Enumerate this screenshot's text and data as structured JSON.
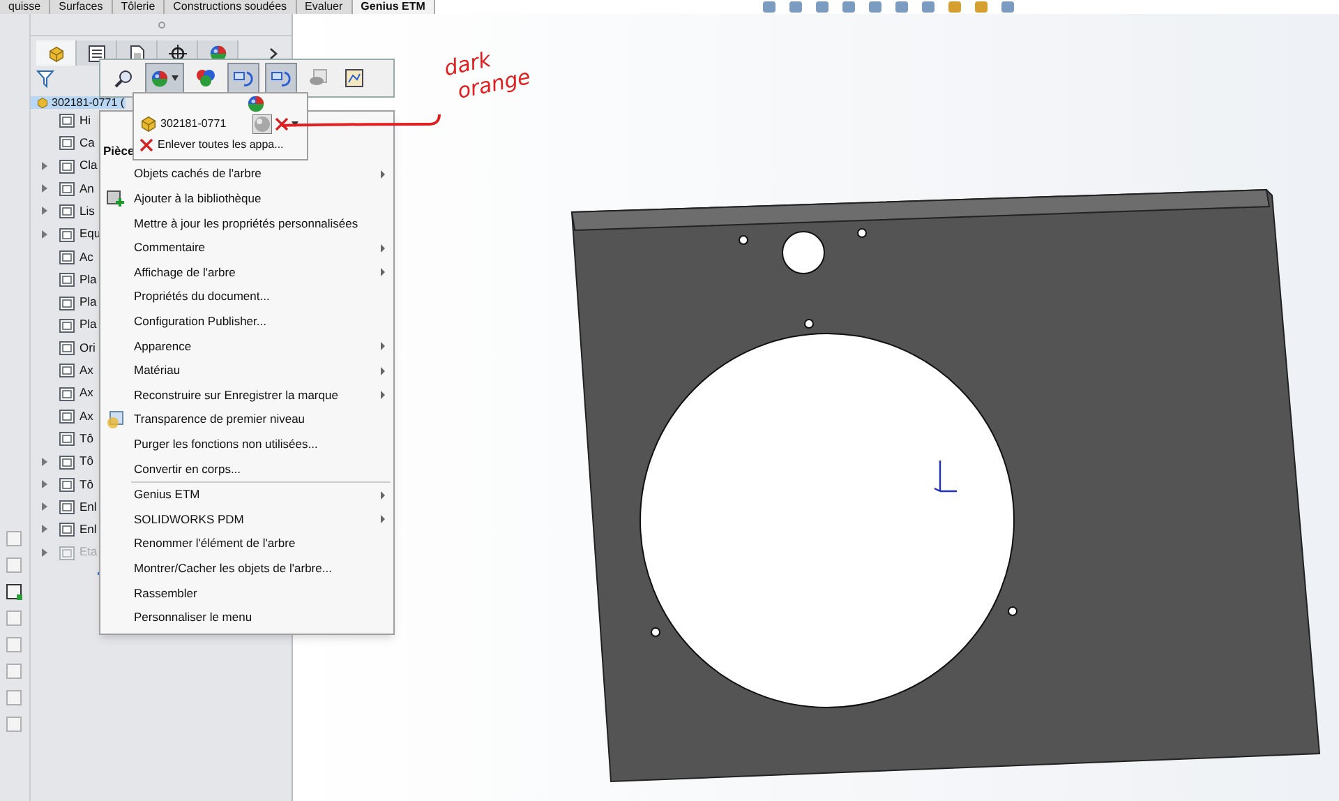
{
  "ribbon_tabs": [
    {
      "label": "quisse",
      "selected": false
    },
    {
      "label": "Surfaces",
      "selected": false
    },
    {
      "label": "Tôlerie",
      "selected": false
    },
    {
      "label": "Constructions soudées",
      "selected": false
    },
    {
      "label": "Evaluer",
      "selected": false
    },
    {
      "label": "Genius ETM",
      "selected": true
    }
  ],
  "panel_tabs": [
    {
      "kind": "part",
      "selected": true
    },
    {
      "kind": "properties",
      "selected": false
    },
    {
      "kind": "config",
      "selected": false
    },
    {
      "kind": "target",
      "selected": false
    },
    {
      "kind": "appearance",
      "selected": false
    }
  ],
  "tree": {
    "root": {
      "label": "302181-0771 (",
      "selected": true
    },
    "items": [
      {
        "label": "Hi",
        "expandable": false,
        "disabled": false
      },
      {
        "label": "Ca",
        "expandable": false,
        "disabled": false
      },
      {
        "label": "Cla",
        "expandable": true,
        "disabled": false
      },
      {
        "label": "An",
        "expandable": true,
        "disabled": false
      },
      {
        "label": "Lis",
        "expandable": true,
        "disabled": false
      },
      {
        "label": "Equ",
        "expandable": true,
        "disabled": false
      },
      {
        "label": "Ac",
        "expandable": false,
        "disabled": false
      },
      {
        "label": "Pla",
        "expandable": false,
        "disabled": false
      },
      {
        "label": "Pla",
        "expandable": false,
        "disabled": false
      },
      {
        "label": "Pla",
        "expandable": false,
        "disabled": false
      },
      {
        "label": "Ori",
        "expandable": false,
        "disabled": false
      },
      {
        "label": "Ax",
        "expandable": false,
        "disabled": false
      },
      {
        "label": "Ax",
        "expandable": false,
        "disabled": false
      },
      {
        "label": "Ax",
        "expandable": false,
        "disabled": false
      },
      {
        "label": "Tô",
        "expandable": false,
        "disabled": false
      },
      {
        "label": "Tô",
        "expandable": true,
        "disabled": false
      },
      {
        "label": "Tô",
        "expandable": true,
        "disabled": false
      },
      {
        "label": "Enl",
        "expandable": true,
        "disabled": false
      },
      {
        "label": "Enl",
        "expandable": true,
        "disabled": false
      },
      {
        "label": "Eta",
        "expandable": true,
        "disabled": true
      }
    ]
  },
  "flyout_toolbar": [
    {
      "kind": "zoom",
      "pressed": false
    },
    {
      "kind": "appearance",
      "pressed": true
    },
    {
      "kind": "colors",
      "pressed": false
    },
    {
      "kind": "rotate",
      "pressed": true
    },
    {
      "kind": "rotate2",
      "pressed": true
    },
    {
      "kind": "view",
      "pressed": false
    },
    {
      "kind": "sheet",
      "pressed": false
    }
  ],
  "appearance_popup": {
    "part_label": "302181-0771",
    "remove_label": "Enlever toutes les appa..."
  },
  "context_menu": {
    "header": "Pièce",
    "items": [
      {
        "label": "Objets cachés de l'arbre",
        "submenu": true
      },
      {
        "label": "Ajouter à la bibliothèque",
        "submenu": false,
        "kind": "library"
      },
      {
        "label": "Mettre à jour les propriétés personnalisées",
        "submenu": false
      },
      {
        "label": "Commentaire",
        "submenu": true
      },
      {
        "label": "Affichage de l'arbre",
        "submenu": true
      },
      {
        "label": "Propriétés du document...",
        "submenu": false
      },
      {
        "label": "Configuration Publisher...",
        "submenu": false
      },
      {
        "label": "Apparence",
        "submenu": true
      },
      {
        "label": "Matériau",
        "submenu": true
      },
      {
        "label": "Reconstruire sur Enregistrer la marque",
        "submenu": true
      },
      {
        "label": "Transparence de premier niveau",
        "submenu": false,
        "kind": "transparency"
      },
      {
        "label": "Purger les fonctions non utilisées...",
        "submenu": false
      },
      {
        "label": "Convertir en corps...",
        "submenu": false
      },
      {
        "label": "Genius ETM",
        "submenu": true,
        "separator_before": true
      },
      {
        "label": "SOLIDWORKS PDM",
        "submenu": true
      },
      {
        "label": "Renommer l'élément de l'arbre",
        "submenu": false
      },
      {
        "label": "Montrer/Cacher les objets de l'arbre...",
        "submenu": false
      },
      {
        "label": "Rassembler",
        "submenu": false
      },
      {
        "label": "Personnaliser le menu",
        "submenu": false
      }
    ]
  },
  "annotation": {
    "lines": [
      "dark",
      "orange"
    ]
  }
}
